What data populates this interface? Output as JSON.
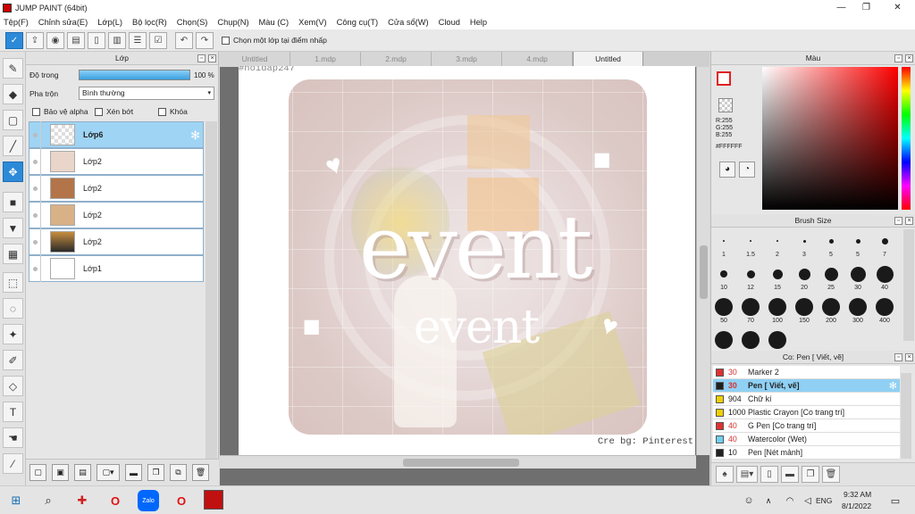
{
  "window": {
    "title": "JUMP PAINT (64bit)",
    "controls": {
      "minimize": "—",
      "maximize": "❐",
      "close": "✕"
    }
  },
  "menu": [
    "Tệp(F)",
    "Chỉnh sửa(E)",
    "Lớp(L)",
    "Bộ lọc(R)",
    "Chọn(S)",
    "Chụp(N)",
    "Màu (C)",
    "Xem(V)",
    "Công cụ(T)",
    "Cửa sổ(W)",
    "Cloud",
    "Help"
  ],
  "command_bar": {
    "checkbox_label": "Chọn một lớp tại điểm nhấp"
  },
  "layer_panel": {
    "title": "Lớp",
    "opacity_label": "Độ trong",
    "opacity_value": "100 %",
    "opacity_fraction": 1.0,
    "blend_label": "Pha trộn",
    "blend_value": "Bình thường",
    "options": [
      "Bảo vệ alpha",
      "Xén bớt",
      "Khóa"
    ],
    "layers": [
      {
        "name": "Lớp6",
        "selected": true
      },
      {
        "name": "Lớp2",
        "selected": false
      },
      {
        "name": "Lớp2",
        "selected": false
      },
      {
        "name": "Lớp2",
        "selected": false
      },
      {
        "name": "Lớp2",
        "selected": false
      },
      {
        "name": "Lớp1",
        "selected": false
      }
    ]
  },
  "canvas": {
    "tabs": [
      "Untitled",
      "1.mdp",
      "2.mdp",
      "3.mdp",
      "4.mdp",
      "Untitled"
    ],
    "active_tab": 5,
    "watermark": "#hoidap247",
    "headline": "event",
    "subheadline": "event",
    "credit": "Cre bg: Pinterest"
  },
  "color_panel": {
    "title": "Màu",
    "r": "R:255",
    "g": "G:255",
    "b": "B:255",
    "hex": "#FFFFFF",
    "main_color": "#ffffff",
    "sub_color": "#ff0000"
  },
  "brush_panel": {
    "title": "Brush Size",
    "sizes": [
      "1",
      "1.5",
      "2",
      "3",
      "5",
      "5",
      "7",
      "10",
      "12",
      "15",
      "20",
      "25",
      "30",
      "40",
      "50",
      "70",
      "100",
      "150",
      "200",
      "300",
      "400",
      "",
      "",
      ""
    ]
  },
  "subtool_panel": {
    "title": "Co: Pen [ Viết, vẽ]",
    "items": [
      {
        "size": "30",
        "name": "Marker 2",
        "color": "#e03030",
        "red": true,
        "selected": false
      },
      {
        "size": "30",
        "name": "Pen [ Viết, vẽ]",
        "color": "#202020",
        "red": true,
        "selected": true
      },
      {
        "size": "904",
        "name": "Chữ kí",
        "color": "#f0d000",
        "red": false,
        "selected": false
      },
      {
        "size": "1000",
        "name": "Plastic Crayon [Co trang trí]",
        "color": "#f0d000",
        "red": false,
        "selected": false
      },
      {
        "size": "40",
        "name": "G Pen [Co trang trí]",
        "color": "#e03030",
        "red": true,
        "selected": false
      },
      {
        "size": "40",
        "name": "Watercolor (Wet)",
        "color": "#6fd0f0",
        "red": true,
        "selected": false
      },
      {
        "size": "10",
        "name": "Pen [Nét mảnh]",
        "color": "#202020",
        "red": false,
        "selected": false
      }
    ]
  },
  "taskbar": {
    "language": "ENG",
    "time": "9:32 AM",
    "date": "8/1/2022",
    "zalo_label": "Zalo"
  }
}
